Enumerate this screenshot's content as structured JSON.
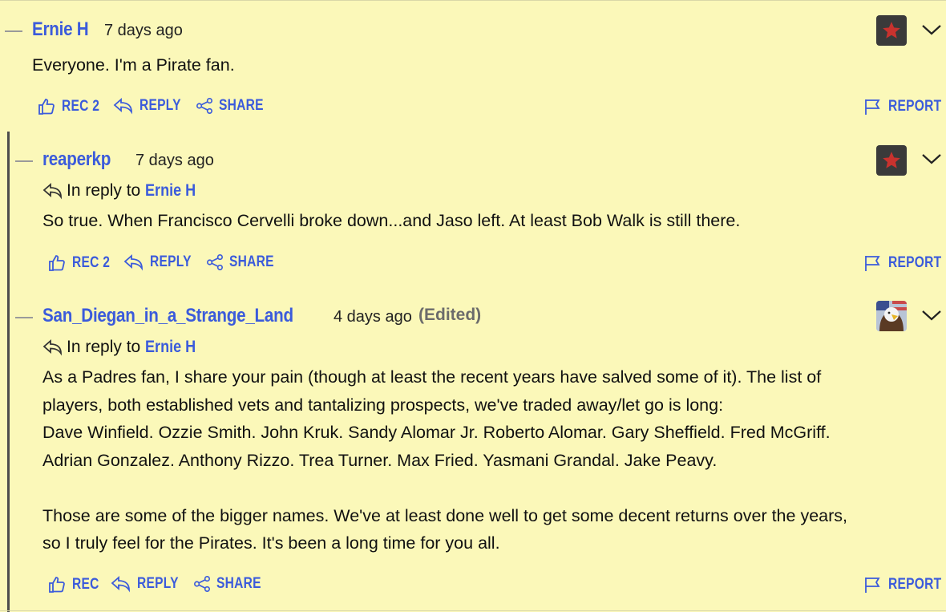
{
  "comments": [
    {
      "author": "Ernie H",
      "time": "7 days ago",
      "body": [
        "Everyone. I'm a Pirate fan."
      ],
      "rec_label": "REC 2",
      "reply_label": "REPLY",
      "share_label": "SHARE",
      "report_label": "REPORT",
      "avatar_icon": "red-star-icon"
    },
    {
      "author": "reaperkp",
      "time": "7 days ago",
      "in_reply_prefix": "In reply to",
      "in_reply_author": "Ernie H",
      "body": [
        "So true. When Francisco Cervelli broke down...and Jaso left. At least Bob Walk is still there."
      ],
      "rec_label": "REC 2",
      "reply_label": "REPLY",
      "share_label": "SHARE",
      "report_label": "REPORT",
      "avatar_icon": "red-star-icon"
    },
    {
      "author": "San_Diegan_in_a_Strange_Land",
      "time": "4 days ago",
      "edited": "(Edited)",
      "in_reply_prefix": "In reply to",
      "in_reply_author": "Ernie H",
      "body": [
        "As a Padres fan, I share your pain (though at least the recent years have salved some of it). The list of",
        "players, both established vets and tantalizing prospects, we've traded away/let go is long:",
        "Dave Winfield. Ozzie Smith. John Kruk. Sandy Alomar Jr. Roberto Alomar. Gary Sheffield. Fred McGriff.",
        "Adrian Gonzalez. Anthony Rizzo. Trea Turner. Max Fried. Yasmani Grandal. Jake Peavy.",
        "",
        "Those are some of the bigger names. We've at least done well to get some decent returns over the years,",
        "so I truly feel for the Pirates. It's been a long time for you all."
      ],
      "rec_label": "REC",
      "reply_label": "REPLY",
      "share_label": "SHARE",
      "report_label": "REPORT",
      "avatar_icon": "eagle-flag-avatar-icon"
    }
  ],
  "colors": {
    "background": "#fbf8b9",
    "link": "#3b5bdb",
    "thread_line": "#4d4d4d"
  }
}
